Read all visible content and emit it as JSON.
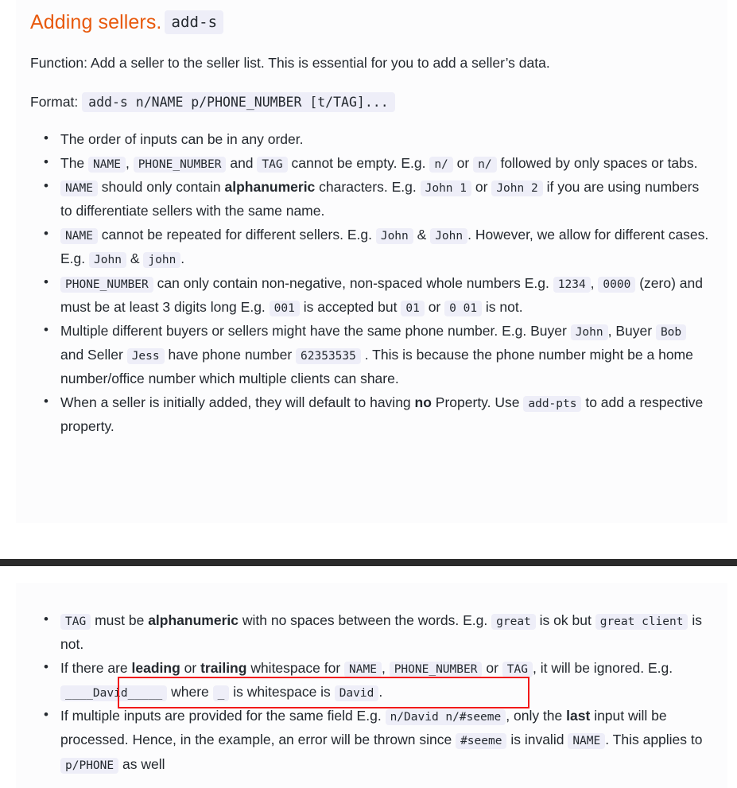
{
  "theme": {
    "accent": "#e8590c",
    "code_bg": "#eeeef8",
    "panel_bg": "#fcfcfd",
    "divider": "#2b2b2b",
    "highlight": "#f21a1a",
    "text": "#24292f"
  },
  "section_top": {
    "title": "Adding sellers.",
    "title_code": "add-s",
    "function_label": "Function:",
    "function_text": "Add a seller to the seller list. This is essential for you to add a seller’s data.",
    "format_label": "Format:",
    "format_code": "add-s n/NAME p/PHONE_NUMBER [t/TAG]...",
    "bullets": {
      "b1": {
        "t1": "The order of inputs can be in any order."
      },
      "b2": {
        "t1": "The",
        "c1": "NAME",
        "t2": ",",
        "c2": "PHONE_NUMBER",
        "t3": "and",
        "c3": "TAG",
        "t4": "cannot be empty. E.g.",
        "c4": "n/",
        "t5": "or",
        "c5": "n/",
        "t6": "followed by only spaces or tabs."
      },
      "b3": {
        "c1": "NAME",
        "t1": "should only contain",
        "b1": "alphanumeric",
        "t2": "characters. E.g.",
        "c2": "John 1",
        "t3": "or",
        "c3": "John 2",
        "t4": "if you are using numbers to differentiate sellers with the same name."
      },
      "b4": {
        "c1": "NAME",
        "t1": "cannot be repeated for different sellers. E.g.",
        "c2": "John",
        "t2": "&",
        "c3": "John",
        "t3": ". However, we allow for different cases. E.g.",
        "c4": "John",
        "t4": "&",
        "c5": "john",
        "t5": "."
      },
      "b5": {
        "c1": "PHONE_NUMBER",
        "t1": "can only contain non-negative, non-spaced whole numbers E.g.",
        "c2": "1234",
        "t2": ",",
        "c3": "0000",
        "t3": "(zero) and must be at least 3 digits long E.g.",
        "c4": "001",
        "t4": "is accepted but",
        "c5": "01",
        "t5": "or",
        "c6": "0 01",
        "t6": "is not."
      },
      "b6": {
        "t1": "Multiple different buyers or sellers might have the same phone number. E.g. Buyer",
        "c1": "John",
        "t2": ", Buyer",
        "c2": "Bob",
        "t3": "and Seller",
        "c3": "Jess",
        "t4": "have phone number",
        "c4": "62353535",
        "t5": ". This is because the phone number might be a home number/office number which multiple clients can share."
      },
      "b7": {
        "t1": "When a seller is initially added, they will default to having",
        "b1": "no",
        "t2": "Property. Use",
        "c1": "add-pts",
        "t3": "to add a respective property."
      }
    }
  },
  "section_bottom": {
    "bullets": {
      "b1": {
        "c1": "TAG",
        "t1": "must be",
        "b1": "alphanumeric",
        "t2": "with no spaces between the words. E.g.",
        "c2": "great",
        "t3": "is ok but",
        "c3": "great client",
        "t4": "is not."
      },
      "b2": {
        "t1": "If there are",
        "b1": "leading",
        "t2": "or",
        "b2": "trailing",
        "t3": "whitespace for",
        "c1": "NAME",
        "t4": ",",
        "c2": "PHONE_NUMBER",
        "t5": "or",
        "c3": "TAG",
        "t6": ", it will be ignored.",
        "t7": "E.g.",
        "c4": "____David_____",
        "t8": "where",
        "c5": "_",
        "t9": "is whitespace is",
        "c6": "David",
        "t10": "."
      },
      "b3": {
        "t1": "If multiple inputs are provided for the same field E.g.",
        "c1": "n/David n/#seeme",
        "t2": ", only the",
        "b1": "last",
        "t3": "input will be processed. Hence, in the example, an error will be thrown since",
        "c2": "#seeme",
        "t4": "is invalid",
        "c3": "NAME",
        "t5": ". This applies to",
        "c4": "p/PHONE",
        "t6": "as well"
      }
    }
  }
}
